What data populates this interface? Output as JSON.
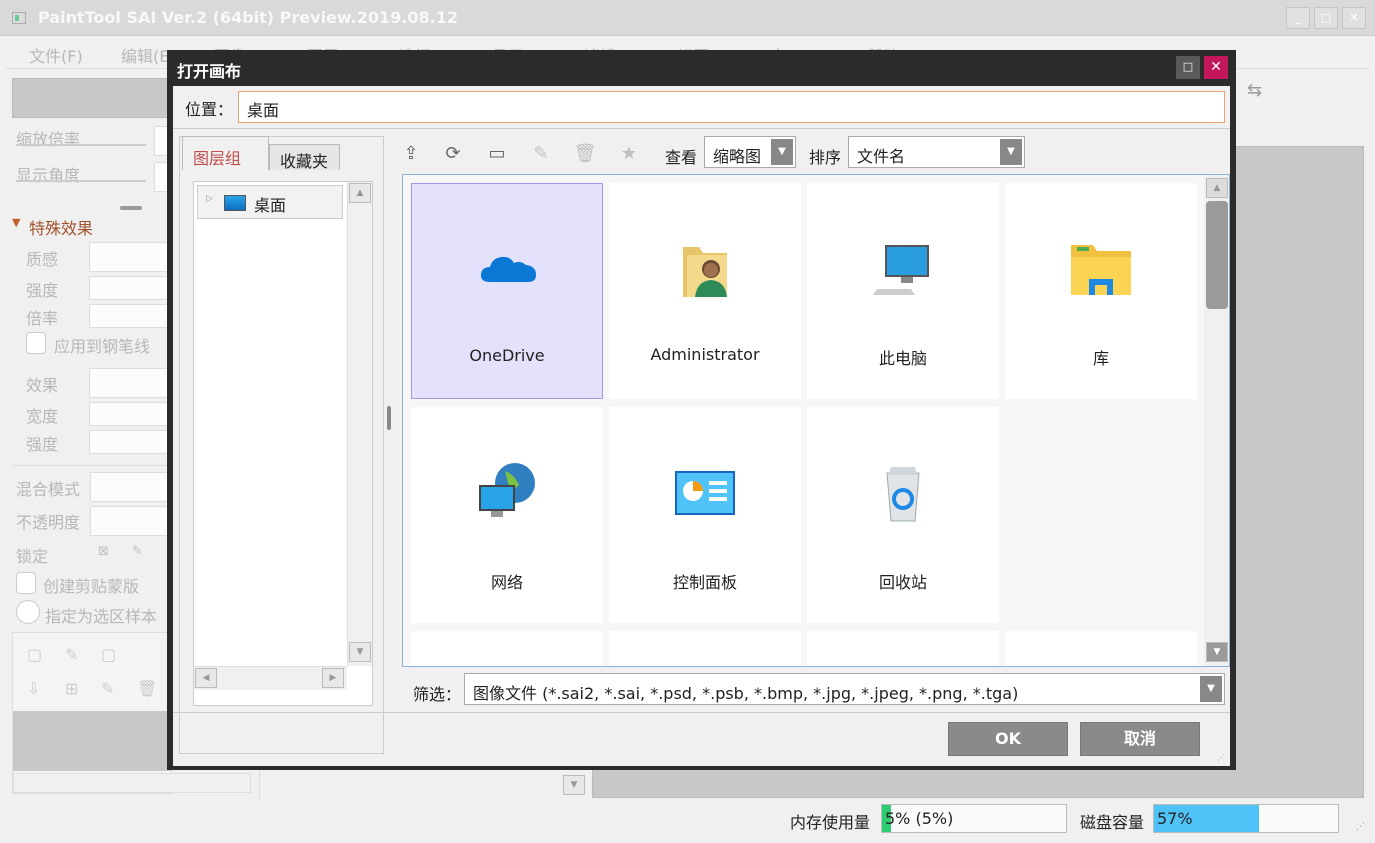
{
  "app": {
    "title": "PaintTool SAI Ver.2 (64bit) Preview.2019.08.12",
    "window_buttons": [
      "_",
      "□",
      "✕"
    ]
  },
  "menu": [
    "文件(F)",
    "编辑(E)",
    "图像(C)",
    "图层(L)",
    "选择(S)",
    "显示(D)",
    "滤镜(T)",
    "视图(V)",
    "窗口(W)",
    "帮助(H)"
  ],
  "left_panel": {
    "zoom_label": "缩放倍率",
    "angle_label": "显示角度",
    "effects_header": "特殊效果",
    "texture_label": "质感",
    "strength_label": "强度",
    "scale_label": "倍率",
    "apply_pen_label": "应用到钢笔线",
    "effect_label": "效果",
    "width_label": "宽度",
    "strength2_label": "强度",
    "blend_label": "混合模式",
    "opacity_label": "不透明度",
    "lock_label": "锁定",
    "clip_label": "创建剪贴蒙版",
    "sel_sample_label": "指定为选区样本"
  },
  "dialog": {
    "title": "打开画布",
    "location_label": "位置：",
    "location_value": "桌面",
    "tabs": [
      "图层组",
      "收藏夹"
    ],
    "tree": [
      "桌面"
    ],
    "view_label": "查看",
    "view_value": "缩略图",
    "sort_label": "排序",
    "sort_value": "文件名",
    "items": [
      {
        "label": "OneDrive",
        "icon": "onedrive-icon",
        "selected": true
      },
      {
        "label": "Administrator",
        "icon": "user-folder-icon",
        "selected": false
      },
      {
        "label": "此电脑",
        "icon": "computer-icon",
        "selected": false
      },
      {
        "label": "库",
        "icon": "library-folder-icon",
        "selected": false
      },
      {
        "label": "网络",
        "icon": "network-icon",
        "selected": false
      },
      {
        "label": "控制面板",
        "icon": "control-panel-icon",
        "selected": false
      },
      {
        "label": "回收站",
        "icon": "recycle-bin-icon",
        "selected": false
      }
    ],
    "filter_label": "筛选：",
    "filter_value": "图像文件 (*.sai2, *.sai, *.psd, *.psb, *.bmp, *.jpg, *.jpeg, *.png, *.tga)",
    "ok_label": "OK",
    "cancel_label": "取消"
  },
  "status": {
    "memory_label": "内存使用量",
    "memory_value": "5% (5%)",
    "memory_percent": 5,
    "disk_label": "磁盘容量",
    "disk_value": "57%",
    "disk_percent": 57,
    "memory_color": "#2ecc71",
    "disk_color": "#4fc3f7"
  }
}
